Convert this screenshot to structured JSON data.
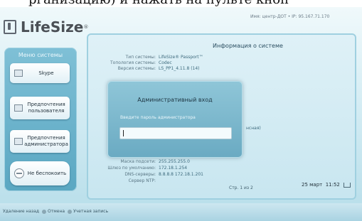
{
  "top_caption": "рганизацию) и нажать на пульте кноп",
  "brand": {
    "name": "LifeSize",
    "mark": "®"
  },
  "host_info": "Имя: центр-ДОТ • IP: 95.167.71.170",
  "system_menu": {
    "title": "Меню системы",
    "items": [
      {
        "label": "Skype",
        "icon": "skype-icon"
      },
      {
        "label": "Предпочтения пользователя",
        "icon": "user-preferences-icon"
      },
      {
        "label": "Предпочтения администратора",
        "icon": "admin-preferences-icon"
      },
      {
        "label": "Не беспокоить",
        "icon": "do-not-disturb-icon"
      }
    ]
  },
  "system_info": {
    "title": "Информация о системе",
    "rows": [
      {
        "key": "Тип системы:",
        "value": "LifeSize® Passport™"
      },
      {
        "key": "Топология системы:",
        "value": "Codec"
      },
      {
        "key": "Версия системы:",
        "value": "LS_PP1_4.11.8 (14)"
      },
      {
        "key": "Маска подсети:",
        "value": "255.255.255.0"
      },
      {
        "key": "Шлюз по умолчанию:",
        "value": "172.18.1.254"
      },
      {
        "key": "DNS-серверы:",
        "value": "8.8.8.8 172.18.1.201"
      },
      {
        "key": "Сервер NTP:",
        "value": ""
      }
    ],
    "page_indicator": "Стр. 1 из 2"
  },
  "admin_login": {
    "title": "Административный вход",
    "prompt": "Введите пароль администратора",
    "password_value": "",
    "clipped_text": "нсная)"
  },
  "footer": {
    "hints": [
      "Удаление назад",
      "Отмена",
      "Учетная запись"
    ],
    "date": "25 март",
    "time": "11:52"
  },
  "colors": {
    "screen_bg": "#cfeaf2",
    "menu_bg": "#6fb4cc",
    "dialog_bg": "#7cb8cd"
  }
}
